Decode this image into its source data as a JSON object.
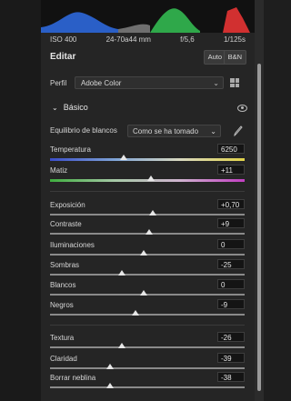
{
  "info": {
    "iso": "ISO 400",
    "lens": "24-70a44 mm",
    "aperture": "f/5,6",
    "shutter": "1/125s"
  },
  "header": {
    "title": "Editar",
    "auto_label": "Auto",
    "bw_label": "B&N"
  },
  "profile": {
    "label": "Perfil",
    "value": "Adobe Color"
  },
  "section": {
    "title": "Básico"
  },
  "wb": {
    "label": "Equilibrio de blancos",
    "value": "Como se ha tomado"
  },
  "sliders": {
    "temperatura": {
      "label": "Temperatura",
      "value": "6250",
      "level": 0.38
    },
    "matiz": {
      "label": "Matiz",
      "value": "+11",
      "level": 0.52
    },
    "exposicion": {
      "label": "Exposición",
      "value": "+0,70",
      "level": 0.53
    },
    "contraste": {
      "label": "Contraste",
      "value": "+9",
      "level": 0.51
    },
    "iluminaciones": {
      "label": "Iluminaciones",
      "value": "0",
      "level": 0.48
    },
    "sombras": {
      "label": "Sombras",
      "value": "-25",
      "level": 0.37
    },
    "blancos": {
      "label": "Blancos",
      "value": "0",
      "level": 0.48
    },
    "negros": {
      "label": "Negros",
      "value": "-9",
      "level": 0.44
    },
    "textura": {
      "label": "Textura",
      "value": "-26",
      "level": 0.37
    },
    "claridad": {
      "label": "Claridad",
      "value": "-39",
      "level": 0.31
    },
    "borrar_neblina": {
      "label": "Borrar neblina",
      "value": "-38",
      "level": 0.31
    }
  }
}
